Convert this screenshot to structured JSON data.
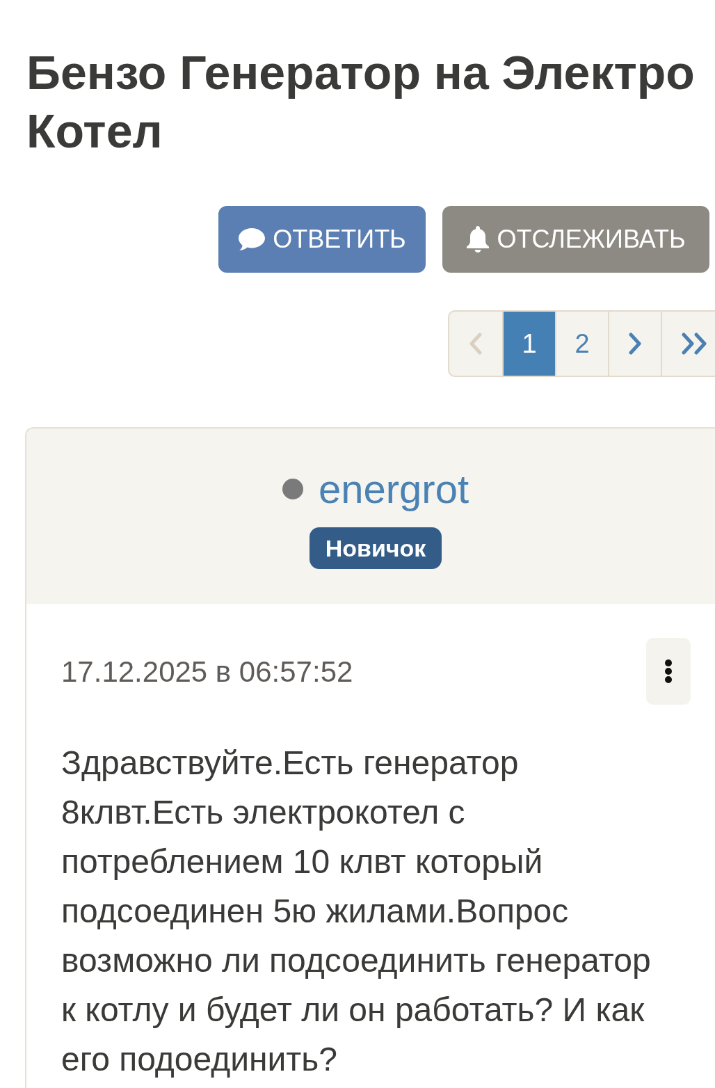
{
  "thread": {
    "title": "Бензо Генератор на Электро Котел"
  },
  "actions": [
    {
      "kind": "reply",
      "label": "ОТВЕТИТЬ"
    },
    {
      "kind": "watch",
      "label": "ОТСЛЕЖИВАТЬ"
    }
  ],
  "pagination": {
    "items": [
      {
        "kind": "prev",
        "selected": false,
        "disabled": true
      },
      {
        "kind": "page",
        "label": "1",
        "selected": true,
        "disabled": false
      },
      {
        "kind": "page",
        "label": "2",
        "selected": false,
        "disabled": false
      },
      {
        "kind": "next",
        "selected": false,
        "disabled": false
      },
      {
        "kind": "last",
        "selected": false,
        "disabled": false
      }
    ]
  },
  "post": {
    "author": {
      "name": "energrot",
      "online": false,
      "rank": "Новичок"
    },
    "date": "17.12.2025 в 06:57:52",
    "text": "Здравствуйте.Есть генератор 8клвт.Есть электрокотел с потреблением 10 клвт который подсоединен 5ю жилами.Вопрос возможно ли подсоединить генератор к котлу и будет ли он работать? И как его подоединить?"
  }
}
